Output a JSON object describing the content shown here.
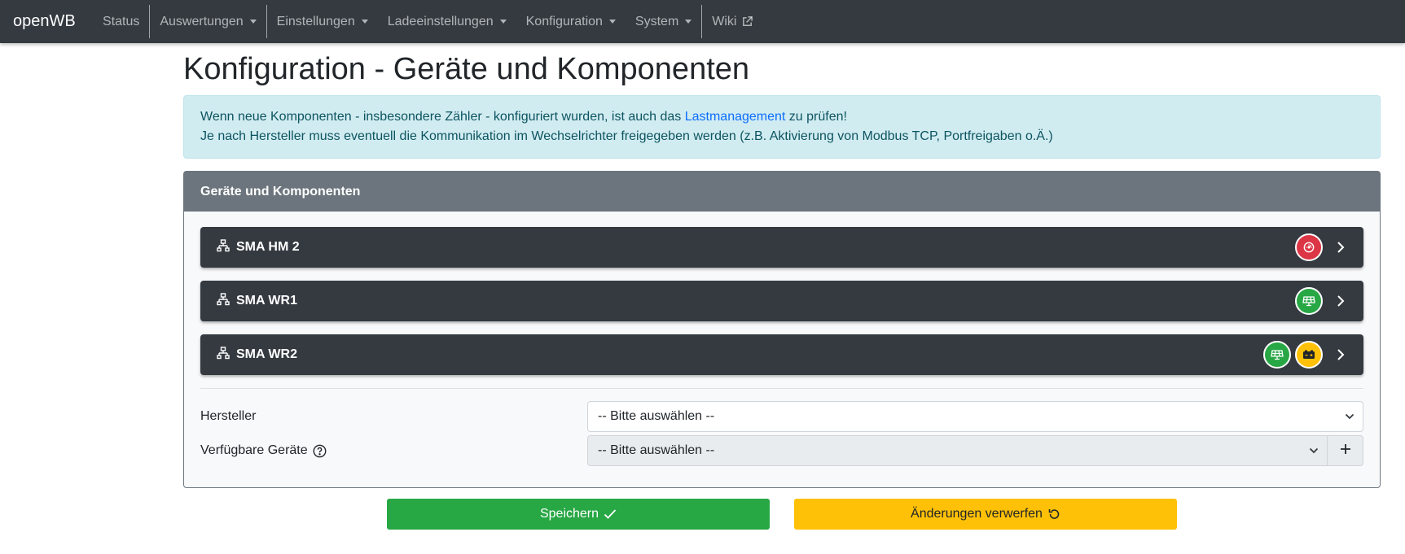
{
  "navbar": {
    "brand": "openWB",
    "items": [
      {
        "label": "Status"
      },
      {
        "label": "Auswertungen"
      },
      {
        "label": "Einstellungen"
      },
      {
        "label": "Ladeeinstellungen"
      },
      {
        "label": "Konfiguration"
      },
      {
        "label": "System"
      },
      {
        "label": "Wiki"
      }
    ]
  },
  "page": {
    "title": "Konfiguration - Geräte und Komponenten"
  },
  "alert": {
    "line1_before": "Wenn neue Komponenten - insbesondere Zähler - konfiguriert wurden, ist auch das ",
    "line1_link": "Lastmanagement",
    "line1_after": " zu prüfen!",
    "line2": "Je nach Hersteller muss eventuell die Kommunikation im Wechselrichter freigegeben werden (z.B. Aktivierung von Modbus TCP, Portfreigaben o.Ä.)"
  },
  "card": {
    "header": "Geräte und Komponenten",
    "devices": [
      {
        "name": "SMA HM 2",
        "components": [
          "counter-icon"
        ]
      },
      {
        "name": "SMA WR1",
        "components": [
          "solar-panel-icon"
        ]
      },
      {
        "name": "SMA WR2",
        "components": [
          "solar-panel-icon",
          "battery-icon"
        ]
      }
    ],
    "manufacturer_label": "Hersteller",
    "manufacturer_value": "-- Bitte auswählen --",
    "devices_label": "Verfügbare Geräte",
    "devices_value": "-- Bitte auswählen --"
  },
  "buttons": {
    "save": "Speichern",
    "discard": "Änderungen verwerfen"
  },
  "colors": {
    "navbar": "#343a40",
    "counter_badge": "#dc3545",
    "pv_badge": "#28a745",
    "battery_badge": "#ffc107",
    "save": "#28a745",
    "discard": "#ffc107"
  }
}
